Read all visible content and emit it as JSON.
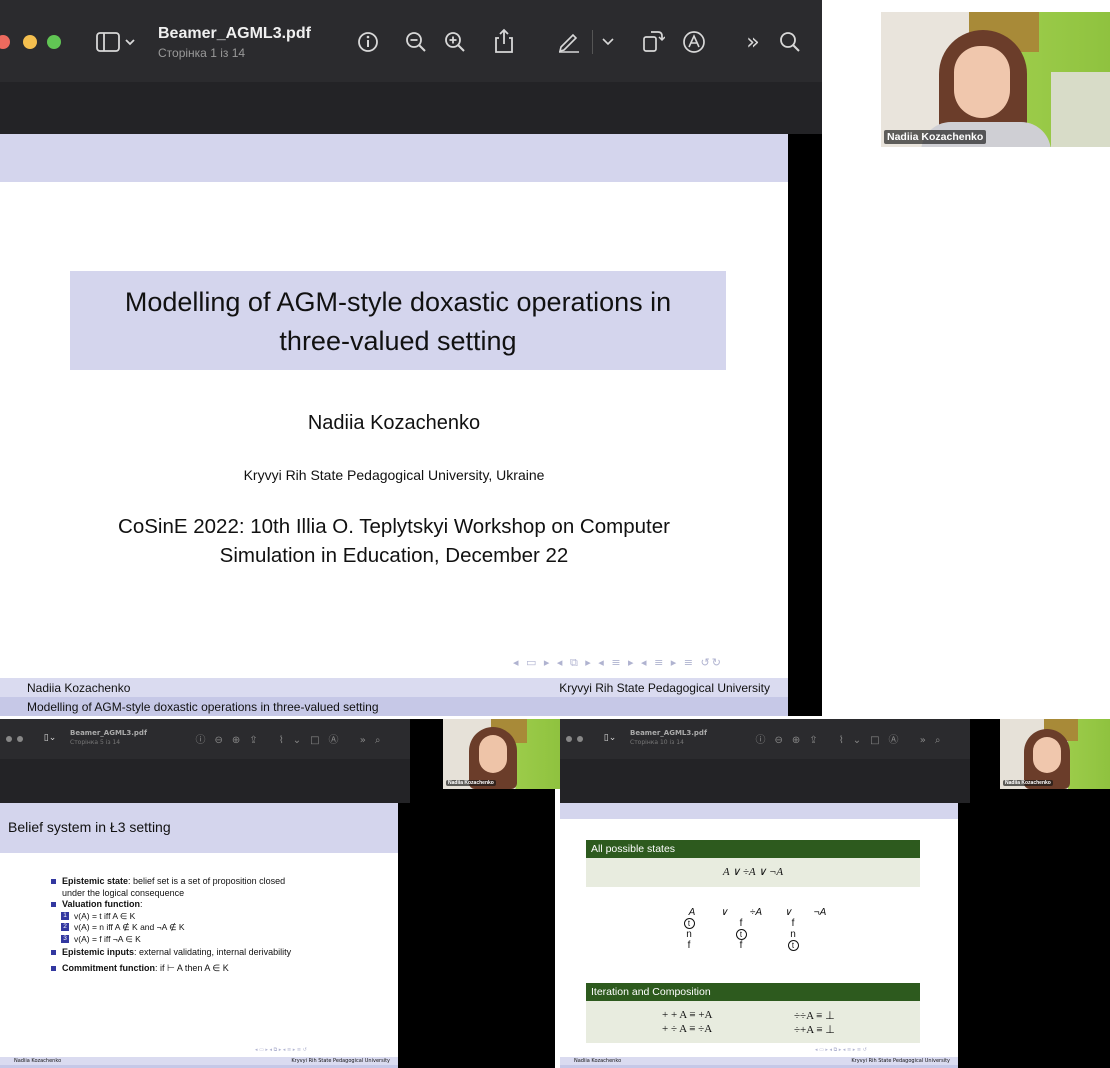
{
  "main": {
    "file_name": "Beamer_AGML3.pdf",
    "page_info": "Сторінка 1 із 14",
    "slide": {
      "title_line1": "Modelling of AGM-style doxastic operations in",
      "title_line2": "three-valued setting",
      "author": "Nadiia Kozachenko",
      "institution": "Kryvyi Rih State Pedagogical University, Ukraine",
      "conference_line1": "CoSinE 2022: 10th Illia O. Teplytskyi Workshop on Computer",
      "conference_line2": "Simulation in Education, December 22",
      "footer_author": "Nadiia Kozachenko",
      "footer_university": "Kryvyi Rih State Pedagogical University",
      "footer_title": "Modelling of AGM-style doxastic operations in three-valued setting"
    },
    "webcam_name": "Nadiia Kozachenko"
  },
  "bottom_left": {
    "file_name": "Beamer_AGML3.pdf",
    "page_info": "Сторінка 5 із 14",
    "frame_title": "Belief system in Ł3 setting",
    "bullets": [
      {
        "bold": "Epistemic state",
        "text": ": belief set is a set of proposition closed"
      },
      {
        "text": "under the logical consequence"
      },
      {
        "bold": "Valuation function",
        "text": ":"
      },
      {
        "num": "1",
        "text": "v(A) = t iff A ∈ K"
      },
      {
        "num": "2",
        "text": "v(A) = n iff A ∉ K and ¬A ∉ K"
      },
      {
        "num": "3",
        "text": "v(A) = f iff ¬A ∈ K"
      },
      {
        "bold": "Epistemic inputs",
        "text": ": external validating, internal derivability"
      },
      {
        "bold": "Commitment function",
        "text": ": if ⊢ A then A ∈ K"
      }
    ],
    "footer_author": "Nadiia Kozachenko",
    "footer_university": "Kryvyi Rih State Pedagogical University",
    "webcam_name": "Nadiia Kozachenko"
  },
  "bottom_right": {
    "file_name": "Beamer_AGML3.pdf",
    "page_info": "Сторінка 10 із 14",
    "block1_title": "All possible states",
    "block1_formula": "A ∨ ÷A ∨ ¬A",
    "table_header": [
      "A",
      "∨",
      "÷A",
      "∨",
      "¬A"
    ],
    "table_rows": [
      [
        "t",
        "f",
        "f"
      ],
      [
        "n",
        "t",
        "n"
      ],
      [
        "f",
        "f",
        "t"
      ]
    ],
    "block2_title": "Iteration and Composition",
    "block2_left1": "+ + A ≡ +A",
    "block2_left2": "+ ÷ A ≡ ÷A",
    "block2_right1": "÷÷A ≡ ⊥",
    "block2_right2": "÷+A ≡ ⊥",
    "footer_author": "Nadiia Kozachenko",
    "footer_university": "Kryvyi Rih State Pedagogical University",
    "webcam_name": "Nadiia Kozachenko"
  },
  "colors": {
    "beamer_band": "#d4d5ed",
    "beamer_accent": "#3338a0",
    "block_green": "#2d5a1e",
    "titlebar": "#2b2b2e"
  }
}
